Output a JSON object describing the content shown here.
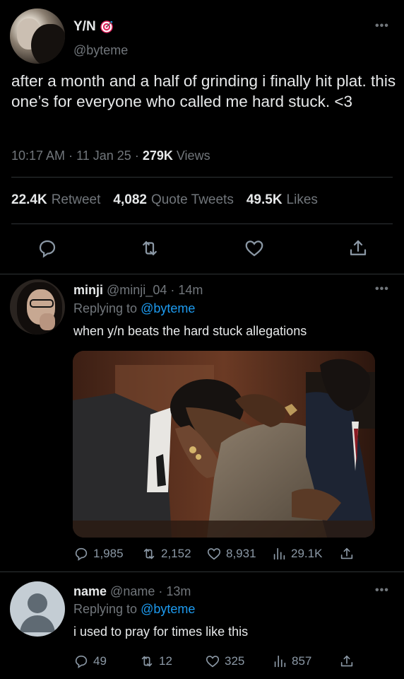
{
  "main_tweet": {
    "author_name": "Y/N",
    "author_badge": "target-emoji",
    "handle": "@byteme",
    "text": "after a month and a half of grinding i finally hit plat. this one’s for everyone who called me hard stuck. <3",
    "time": "10:17 AM",
    "date": "11 Jan 25",
    "views_count": "279K",
    "views_label": "Views",
    "retweets_count": "22.4K",
    "retweets_label": "Retweet",
    "quotes_count": "4,082",
    "quotes_label": "Quote Tweets",
    "likes_count": "49.5K",
    "likes_label": "Likes"
  },
  "replies": [
    {
      "author_name": "minji",
      "handle": "@minji_04",
      "time": "14m",
      "replying_label": "Replying to",
      "replying_to": "@byteme",
      "text": "when y/n beats the hard stuck allegations",
      "replies": "1,985",
      "retweets": "2,152",
      "likes": "8,931",
      "views": "29.1K"
    },
    {
      "author_name": "name",
      "handle": "@name",
      "time": "13m",
      "replying_label": "Replying to",
      "replying_to": "@byteme",
      "text": "i used to pray for times like this",
      "replies": "49",
      "retweets": "12",
      "likes": "325",
      "views": "857"
    }
  ],
  "colors": {
    "background": "#000000",
    "text": "#e7e9ea",
    "muted": "#71767b",
    "accent": "#1d9bf0",
    "divider": "#2f3336"
  },
  "icons": [
    "more-icon",
    "reply-icon",
    "retweet-icon",
    "like-icon",
    "share-icon",
    "views-icon"
  ]
}
